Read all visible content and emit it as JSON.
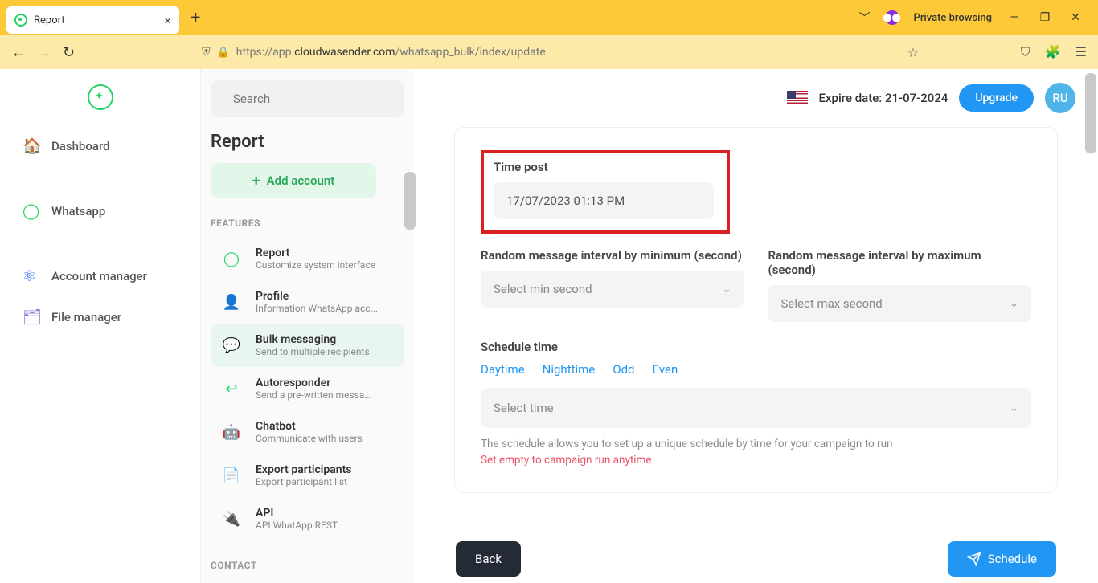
{
  "browser": {
    "tab_title": "Report",
    "private_label": "Private browsing",
    "url_prefix": "https://app.",
    "url_domain": "cloudwasender.com",
    "url_path": "/whatsapp_bulk/index/update"
  },
  "leftnav": {
    "items": [
      {
        "label": "Dashboard",
        "icon": "home"
      },
      {
        "label": "Whatsapp",
        "icon": "whatsapp"
      },
      {
        "label": "Account manager",
        "icon": "nodes"
      },
      {
        "label": "File manager",
        "icon": "folder"
      }
    ]
  },
  "col2": {
    "search_placeholder": "Search",
    "heading": "Report",
    "add_account": "Add account",
    "section_features": "FEATURES",
    "section_contact": "CONTACT",
    "features": [
      {
        "title": "Report",
        "sub": "Customize system interface",
        "icon": "whatsapp"
      },
      {
        "title": "Profile",
        "sub": "Information WhatsApp acc...",
        "icon": "user"
      },
      {
        "title": "Bulk messaging",
        "sub": "Send to multiple recipients",
        "icon": "chat",
        "active": true
      },
      {
        "title": "Autoresponder",
        "sub": "Send a pre-written messa...",
        "icon": "reply"
      },
      {
        "title": "Chatbot",
        "sub": "Communicate with users",
        "icon": "robot"
      },
      {
        "title": "Export participants",
        "sub": "Export participant list",
        "icon": "export"
      },
      {
        "title": "API",
        "sub": "API WhatApp REST",
        "icon": "plug"
      }
    ]
  },
  "topbar": {
    "expire": "Expire date: 21-07-2024",
    "upgrade": "Upgrade",
    "avatar": "RU"
  },
  "form": {
    "time_post_label": "Time post",
    "time_post_value": "17/07/2023 01:13 PM",
    "min_label": "Random message interval by minimum (second)",
    "min_placeholder": "Select min second",
    "max_label": "Random message interval by maximum (second)",
    "max_placeholder": "Select max second",
    "schedule_label": "Schedule time",
    "schedule_tabs": [
      "Daytime",
      "Nighttime",
      "Odd",
      "Even"
    ],
    "select_time_placeholder": "Select time",
    "hint": "The schedule allows you to set up a unique schedule by time for your campaign to run",
    "hint_red": "Set empty to campaign run anytime",
    "back": "Back",
    "schedule": "Schedule"
  }
}
